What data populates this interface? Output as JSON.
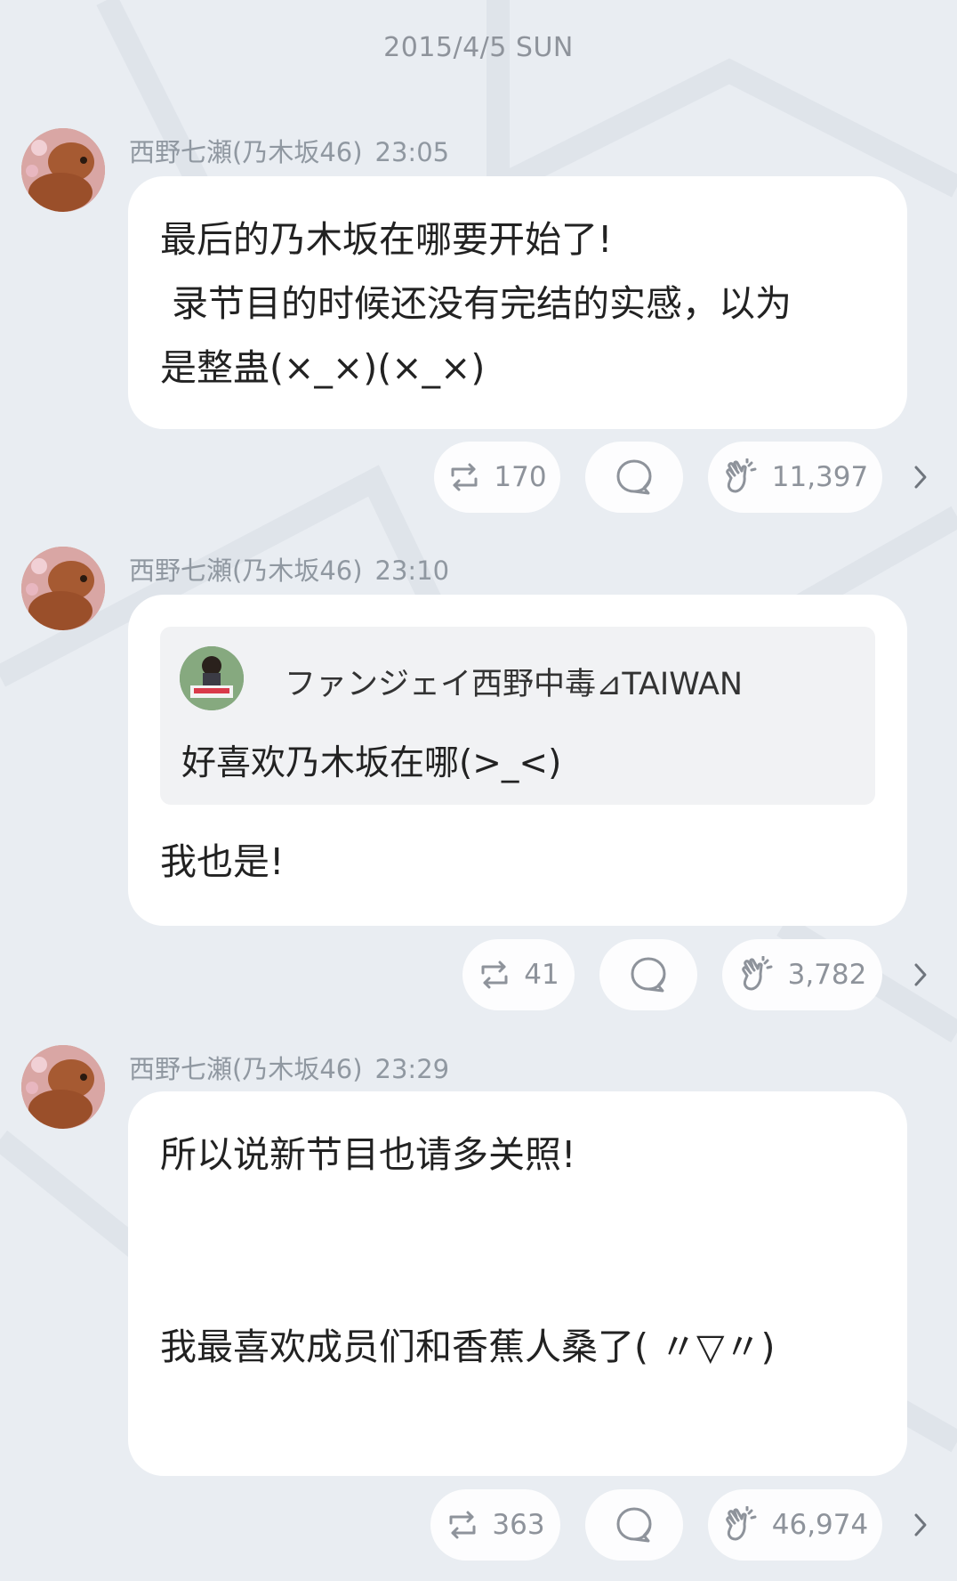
{
  "date_header": "2015/4/5 SUN",
  "posts": [
    {
      "author": "西野七瀬(乃木坂46)",
      "time": "23:05",
      "message": "最后的乃木坂在哪要开始了!\n 录节目的时候还没有完结的实感，以为\n是整蛊(×_×)(×_×)",
      "retweets": "170",
      "likes": "11,397"
    },
    {
      "author": "西野七瀬(乃木坂46)",
      "time": "23:10",
      "quote": {
        "name": "ファンジェイ西野中毒⊿TAIWAN",
        "text": "好喜欢乃木坂在哪(>_<)"
      },
      "message": "我也是!",
      "retweets": "41",
      "likes": "3,782"
    },
    {
      "author": "西野七瀬(乃木坂46)",
      "time": "23:29",
      "message": "所以说新节目也请多关照!\n\n\n我最喜欢成员们和香蕉人桑了( 〃▽〃)",
      "retweets": "363",
      "likes": "46,974"
    }
  ],
  "icons": {
    "retweet": "retweet-icon",
    "comment": "comment-icon",
    "like": "clap-icon",
    "more": "chevron-right-icon"
  },
  "colors": {
    "background": "#e9edf2",
    "bubble": "#ffffff",
    "meta_text": "#9098a1",
    "icon": "#8e939b"
  }
}
